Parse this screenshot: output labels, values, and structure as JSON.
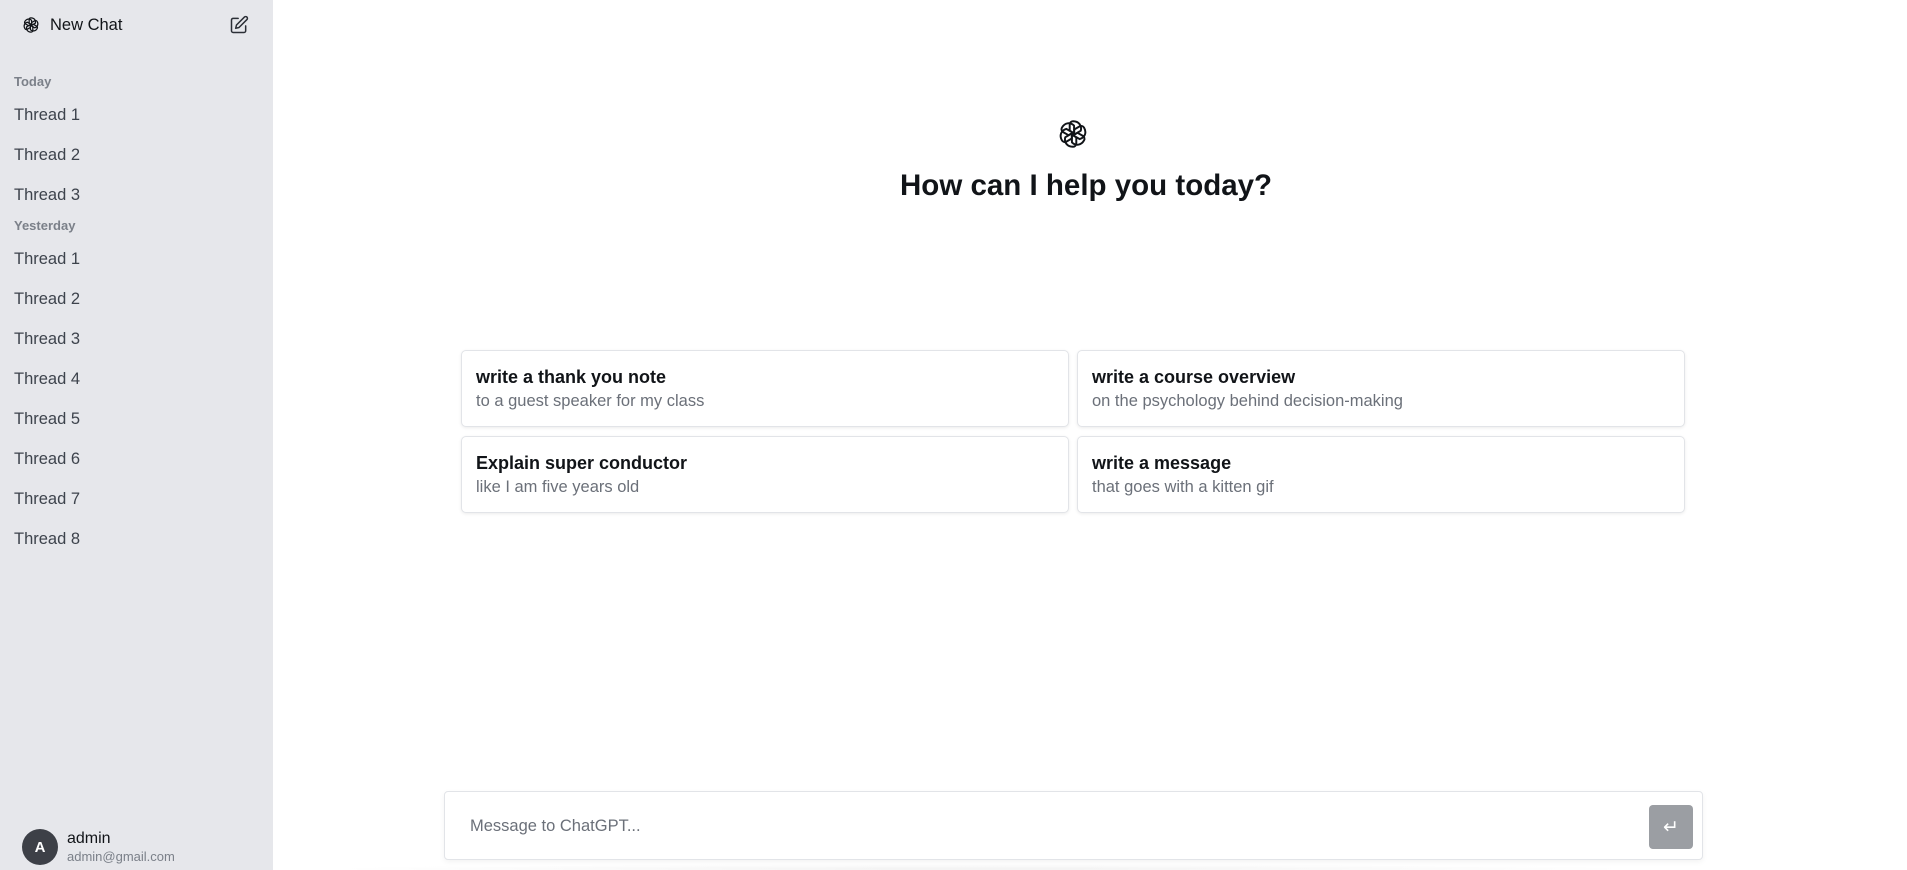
{
  "sidebar": {
    "new_chat_label": "New Chat",
    "sections": [
      {
        "label": "Today",
        "threads": [
          "Thread 1",
          "Thread 2",
          "Thread 3"
        ]
      },
      {
        "label": "Yesterday",
        "threads": [
          "Thread 1",
          "Thread 2",
          "Thread 3",
          "Thread 4",
          "Thread 5",
          "Thread 6",
          "Thread 7",
          "Thread 8"
        ]
      }
    ],
    "user": {
      "initial": "A",
      "name": "admin",
      "email": "admin@gmail.com"
    }
  },
  "main": {
    "greeting": "How can I help you today?",
    "suggestions": [
      {
        "title": "write a thank you note",
        "subtitle": "to a guest speaker for my class"
      },
      {
        "title": "write a course overview",
        "subtitle": "on the psychology behind decision-making"
      },
      {
        "title": "Explain super conductor",
        "subtitle": "like I am five years old"
      },
      {
        "title": "write a message",
        "subtitle": "that goes with a kitten gif"
      }
    ],
    "composer": {
      "placeholder": "Message to ChatGPT...",
      "value": "",
      "send_icon": "↵"
    }
  },
  "colors": {
    "sidebar_bg": "#e6e7eb",
    "send_button": "#9b9ea3",
    "avatar_bg": "#3d4047"
  }
}
